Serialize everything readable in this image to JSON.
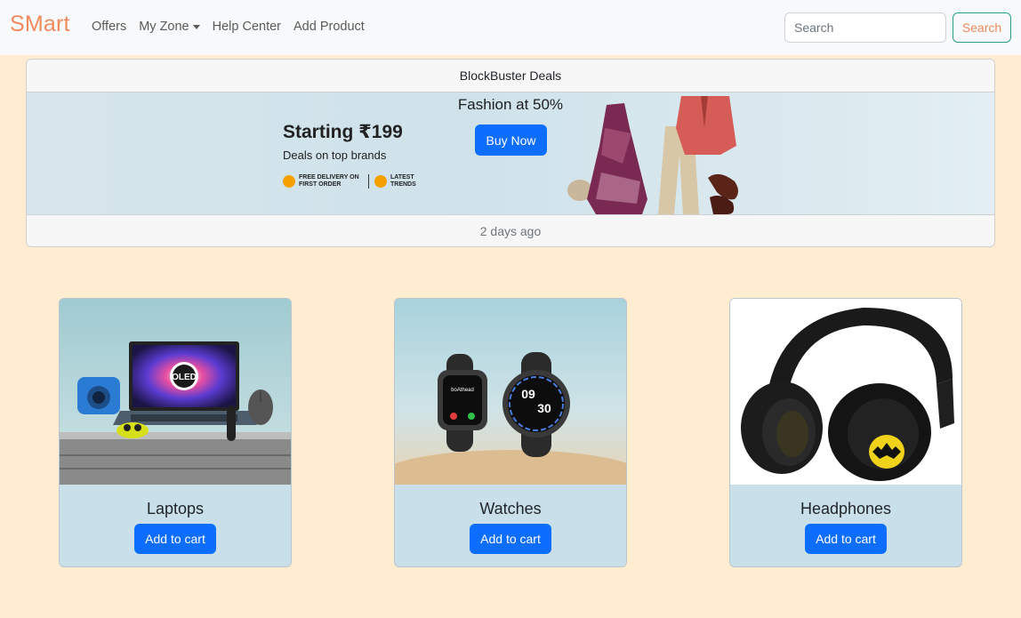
{
  "navbar": {
    "brand": "SMart",
    "links": [
      "Offers",
      "My Zone",
      "Help Center",
      "Add Product"
    ],
    "search_placeholder": "Search",
    "search_button": "Search"
  },
  "deals": {
    "header": "BlockBuster Deals",
    "banner_title": "Fashion at 50%",
    "buy_button": "Buy Now",
    "promo_main": "Starting ₹199",
    "promo_sub": "Deals on top brands",
    "badge_delivery": "FREE DELIVERY ON FIRST ORDER",
    "badge_trends": "LATEST TRENDS",
    "footer": "2 days ago"
  },
  "products": [
    {
      "title": "Laptops",
      "button": "Add to cart",
      "image": "laptop-image"
    },
    {
      "title": "Watches",
      "button": "Add to cart",
      "image": "watches-image"
    },
    {
      "title": "Headphones",
      "button": "Add to cart",
      "image": "headphones-image"
    }
  ],
  "colors": {
    "page_bg": "#ffecd1",
    "brand": "#f08a5d",
    "primary": "#0d6efd",
    "card_bg": "#c9e0ea"
  }
}
